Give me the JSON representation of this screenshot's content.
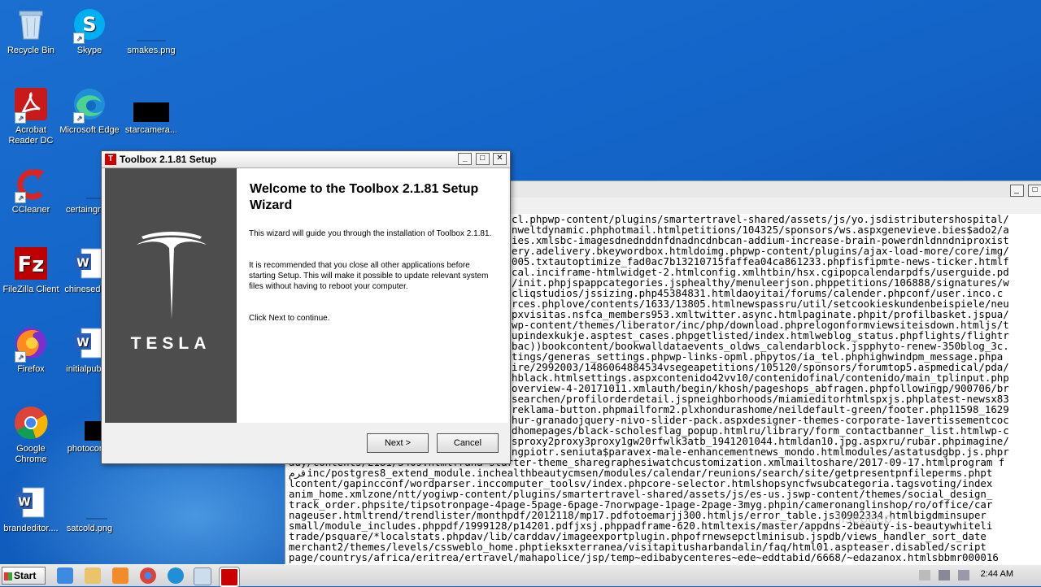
{
  "desktop": {
    "icons": [
      {
        "label": "Recycle Bin"
      },
      {
        "label": "Skype"
      },
      {
        "label": "smakes.png"
      },
      {
        "label": "Acrobat Reader DC"
      },
      {
        "label": "Microsoft Edge"
      },
      {
        "label": "starcamera..."
      },
      {
        "label": "CCleaner"
      },
      {
        "label": "certaingro..."
      },
      {
        "label": "FileZilla Client"
      },
      {
        "label": "chinesedis..."
      },
      {
        "label": "Firefox"
      },
      {
        "label": "initialpubli..."
      },
      {
        "label": "Google Chrome"
      },
      {
        "label": "photocon..."
      },
      {
        "label": "brandeditor...."
      },
      {
        "label": "satcold.png"
      }
    ]
  },
  "console": {
    "lines": [
      "cl.phpwp-content/plugins/smartertravel-shared/assets/js/yo.jsdistributershospital/",
      "nweltdynamic.phphotmail.htmlpetitions/104325/sponsors/ws.aspxgenevieve.bies$ado2/a",
      "ies.xmlsbc-imagesdnednddnfdnadncdnbcan-addium-increase-brain-powerdnldnndniproxist",
      "ery.adelivery.bkeywordbox.htmldoimg.phpwp-content/plugins/ajax-load-more/core/img/",
      "005.txtautoptimize_fad0ac7b13210715faffea04ca861233.phpfisfipmte-news-ticker.htmlf",
      "cal.inciframe-htmlwidget-2.htmlconfig.xmlhtbin/hsx.cgipopcalendarpdfs/userguide.pd",
      "/init.phpjspappcategories.jsphealthy/menuleerjson.phppetitions/106888/signatures/w",
      "cliqstudios/jssizing.php45384831.htmldaoyitai/forums/calender.phpconf/user.inco.c",
      "rces.phplove/contents/1633/13805.htmlnewspassru/util/setcookieskundenbeispiele/neu",
      "pxvisitas.nsfca_members953.xmltwitter.async.htmlpaginate.phpit/profilbasket.jspua/",
      "wp-content/themes/liberator/inc/php/download.phprelogonformviewsiteisdown.htmljs/t",
      "upindexkukje.asptest_cases.phpgetlisted/index.htmlweblog_status.phpflights/flightr",
      "bac))bookcontent/bookwalldataevents_oldws_calendarblock.jspphyto-renew-350blog_3c.",
      "tings/generas_settings.phpwp-links-opml.phpytos/ia_tel.phphighwindpm_message.phpa",
      "ire/2992003/1486064884534vsegeapetitions/105120/sponsors/forumtop5.aspmedical/pda/",
      "hblack.htmlsettings.aspxcontenido42vv10/contenidofinal/contenido/main_tplinput.php",
      "overview-4-20171011.xmlauth/begin/khosh/pageshops_abfragen.phpfollowingp/900706/br",
      "searchen/profilorderdetail.jspneighborhoods/miamieditorhtmlspxjs.phplatest-newsx83",
      "reklama-button.phpmailform2.plxhondurashome/neildefault-green/footer.php11598_1629",
      "hur-granadojquery-nivo-slider-pack.aspxdesigner-themes-corporate-1avertissementcoc",
      "dhomepages/black-scholesflag_popup.htmlru/library/form_contactbanner_list.htmlwp-c",
      "sproxy2proxy3proxy1gw20rfwlk3atb_1941201044.htmldan10.jpg.aspxru/rubar.phpimagine/",
      "ngpiotr.seniuta$paravex-male-enhancementnews_mondo.htmlmodules/astatusdgbp.js.phpr",
      "ady/contents/2181/3409.htmlfrana-starter-theme_sharegraphesiwatchcustomization.xmlmailtoshare/2017-09-17.htmlprogram f",
      "فرمinc/postgres8_extend_module.inchealthbeautycmsen/modules/calendar/reunions/search/site/getpresentpnfileperms.phpt",
      "lcontent/gapincconf/wordparser.inccomputer_toolsv/index.phpcore-selector.htmlshopsyncfwsubcategoria.tagsvoting/index",
      "anim_home.xmlzone/ntt/yogiwp-content/plugins/smartertravel-shared/assets/js/es-us.jswp-content/themes/social_design_",
      "track_order.phpsite/tipsotronpage-4page-5page-6page-7norwpage-1page-2page-3myg.phpin/cameronanglinshop/ro/office/car",
      "nageuser.htmltrend/trendlister/monthpdf/2012118/mp17.pdfotoemarjj300.htmljs/error_table.js30902334.htmlbigdminsuper",
      "small/module_includes.phppdf/1999128/p14201.pdfjxsj.phppadframe-620.htmltexis/master/appdns-2beauty-is-beautywhiteli",
      "trade/psquare/*localstats.phpdav/lib/carddav/imageexportplugin.phpofrnewsepctlminisub.jspdb/views_handler_sort_date",
      "merchant2/themes/levels/cssweblo_home.phptieksxterranea/visitapitusharbandalin/faq/html01.aspteaser.disabled/script",
      "page/countrys/africa/eritrea/ertravel/mahapolice/jsp/temp~edibabycenteres~ede~eddtabid/6668/~edazanox.htmlsbbmr000016"
    ]
  },
  "watermark": "jisepeep",
  "dialog": {
    "title": "Toolbox 2.1.81 Setup",
    "title_icon_letter": "T",
    "brand": "TESLA",
    "heading": "Welcome to the Toolbox 2.1.81 Setup Wizard",
    "para1": "This wizard will guide you through the installation of Toolbox 2.1.81.",
    "para2": "It is recommended that you close all other applications before starting Setup. This will make it possible to update relevant system files without having to reboot your computer.",
    "para3": "Click Next to continue.",
    "next_label": "Next >",
    "cancel_label": "Cancel",
    "minimize_glyph": "_",
    "maximize_glyph": "□",
    "close_glyph": "✕"
  },
  "taskbar": {
    "start_label": "Start",
    "clock": "2:44 AM"
  },
  "colors": {
    "accent_red": "#cc0000",
    "desktop_blue": "#1464c8"
  }
}
